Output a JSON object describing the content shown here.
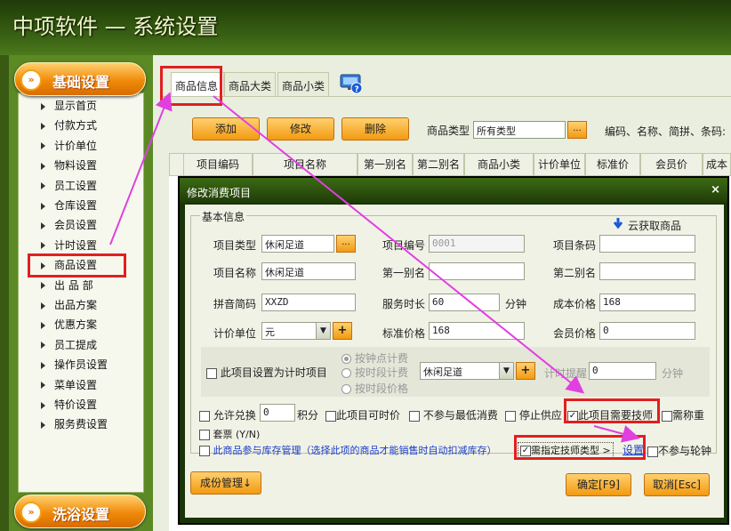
{
  "window": {
    "title": "中项软件 — 系统设置"
  },
  "sidebar": {
    "top_section": "基础设置",
    "items": [
      "显示首页",
      "付款方式",
      "计价单位",
      "物料设置",
      "员工设置",
      "仓库设置",
      "会员设置",
      "计时设置",
      "商品设置",
      "出 品 部",
      "出品方案",
      "优惠方案",
      "员工提成",
      "操作员设置",
      "菜单设置",
      "特价设置",
      "服务费设置"
    ],
    "bottom_section": "洗浴设置",
    "icon": "chevron-right-icon"
  },
  "tabs": [
    "商品信息",
    "商品大类",
    "商品小类"
  ],
  "toolbar": {
    "add": "添加",
    "edit": "修改",
    "delete": "删除",
    "type_label": "商品类型",
    "type_value": "所有类型",
    "dots": "...",
    "search_hint": "编码、名称、简拼、条码:"
  },
  "grid": {
    "columns": [
      "项目编码",
      "项目名称",
      "第一别名",
      "第二别名",
      "商品小类",
      "计价单位",
      "标准价",
      "会员价",
      "成本"
    ]
  },
  "dialog": {
    "title": "修改消费项目",
    "close": "×",
    "group": "基本信息",
    "cloud": "云获取商品",
    "fields": {
      "type_label": "项目类型",
      "type_value": "休闲足道",
      "code_label": "项目编号",
      "code_value": "0001",
      "barcode_label": "项目条码",
      "barcode_value": "",
      "name_label": "项目名称",
      "name_value": "休闲足道",
      "alias1_label": "第一别名",
      "alias1_value": "",
      "alias2_label": "第二别名",
      "alias2_value": "",
      "pinyin_label": "拼音简码",
      "pinyin_value": "XXZD",
      "duration_label": "服务时长",
      "duration_value": "60",
      "duration_unit": "分钟",
      "cost_label": "成本价格",
      "cost_value": "168",
      "unit_label": "计价单位",
      "unit_value": "元",
      "std_label": "标准价格",
      "std_value": "168",
      "member_label": "会员价格",
      "member_value": "0"
    },
    "timing": {
      "checkbox": "此项目设置为计时项目",
      "radio1": "按钟点计费",
      "radio2": "按时段计费",
      "radio3": "按时段价格",
      "select_value": "休闲足道",
      "remind_label": "计时提醒",
      "remind_value": "0",
      "remind_unit": "分钟"
    },
    "options": {
      "exchange": "允许兑换",
      "points_value": "0",
      "points_unit": "积分",
      "anytime": "此项目可时价",
      "nomin": "不参与最低消费",
      "stop": "停止供应",
      "need_tech": "此项目需要技师",
      "weigh": "需称重",
      "set": "套票 (Y/N)",
      "stock": "此商品参与库存管理（选择此项的商品才能销售时自动扣减库存）",
      "tech_type": "需指定技师类型",
      "setup": "设置",
      "no_rotate": "不参与轮钟"
    },
    "buttons": {
      "cost_mgmt": "成份管理↓",
      "ok": "确定[F9]",
      "cancel": "取消[Esc]"
    }
  },
  "colors": {
    "highlight": "#e02020",
    "annotation": "#e040e0",
    "accent": "#f29a10"
  }
}
